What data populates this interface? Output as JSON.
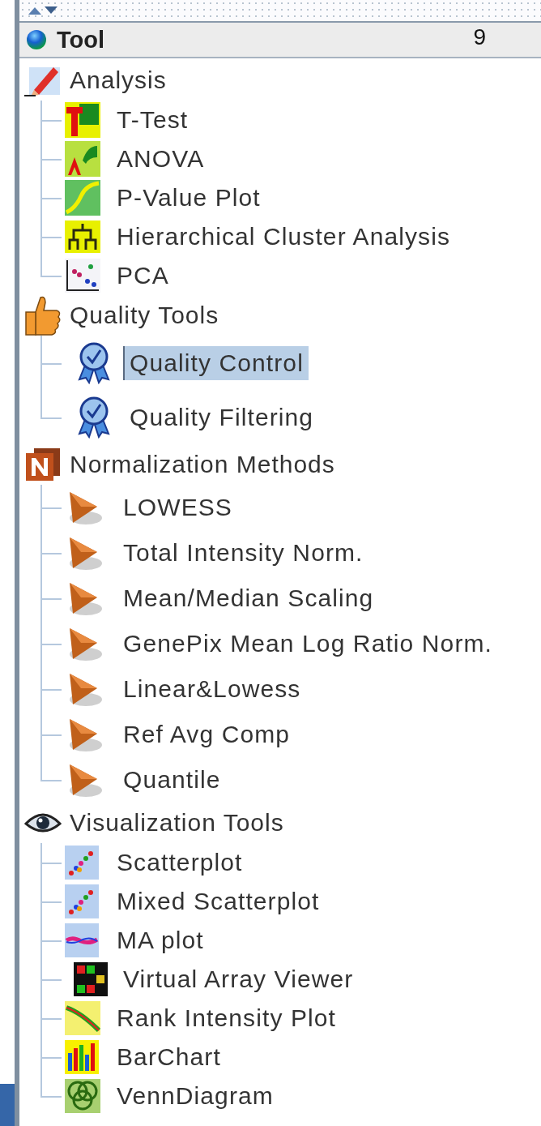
{
  "header": {
    "title": "Tool",
    "count": "9"
  },
  "groups": [
    {
      "label": "Analysis",
      "children": [
        {
          "label": "T-Test",
          "selected": false
        },
        {
          "label": "ANOVA",
          "selected": false
        },
        {
          "label": "P-Value Plot",
          "selected": false
        },
        {
          "label": "Hierarchical Cluster Analysis",
          "selected": false
        },
        {
          "label": "PCA",
          "selected": false
        }
      ]
    },
    {
      "label": "Quality Tools",
      "children": [
        {
          "label": "Quality Control",
          "selected": true
        },
        {
          "label": "Quality Filtering",
          "selected": false
        }
      ]
    },
    {
      "label": "Normalization Methods",
      "children": [
        {
          "label": "LOWESS",
          "selected": false
        },
        {
          "label": "Total Intensity Norm.",
          "selected": false
        },
        {
          "label": "Mean/Median Scaling",
          "selected": false
        },
        {
          "label": "GenePix Mean Log Ratio Norm.",
          "selected": false
        },
        {
          "label": "Linear&Lowess",
          "selected": false
        },
        {
          "label": "Ref Avg Comp",
          "selected": false
        },
        {
          "label": "Quantile",
          "selected": false
        }
      ]
    },
    {
      "label": "Visualization Tools",
      "children": [
        {
          "label": "Scatterplot",
          "selected": false
        },
        {
          "label": "Mixed Scatterplot",
          "selected": false
        },
        {
          "label": "MA plot",
          "selected": false
        },
        {
          "label": "Virtual Array Viewer",
          "selected": false
        },
        {
          "label": "Rank Intensity Plot",
          "selected": false
        },
        {
          "label": "BarChart",
          "selected": false
        },
        {
          "label": "VennDiagram",
          "selected": false
        }
      ]
    }
  ]
}
